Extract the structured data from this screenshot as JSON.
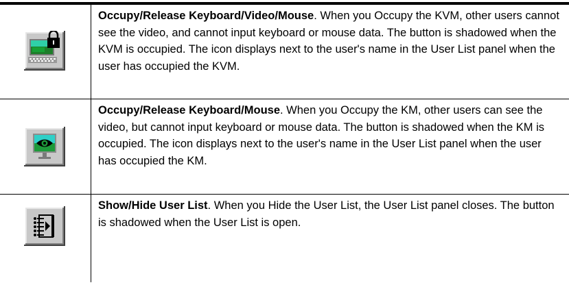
{
  "rows": [
    {
      "icon": "occupy-kvm-icon",
      "title": "Occupy/Release Keyboard/Video/Mouse",
      "description": ". When you Occupy the KVM, other users cannot see the video, and cannot input keyboard or mouse data. The button is shadowed when the KVM is occupied. The icon displays next to the user's name in the User List panel when the user has occupied the KVM."
    },
    {
      "icon": "occupy-km-icon",
      "title": "Occupy/Release Keyboard/Mouse",
      "description": ". When you Occupy the KM, other users can see the video, but cannot input keyboard or mouse data. The button is shadowed when the KM is occupied. The icon displays next to the user's name in the User List panel when the user has occupied the KM."
    },
    {
      "icon": "user-list-icon",
      "title": "Show/Hide User List",
      "description": ". When you Hide the User List, the User List panel closes. The button is shadowed when the User List is open."
    }
  ]
}
